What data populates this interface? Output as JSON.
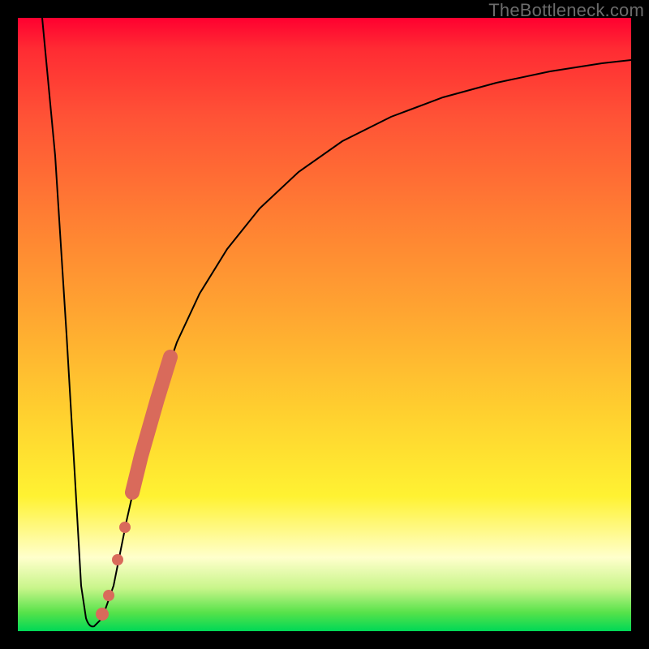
{
  "watermark": "TheBottleneck.com",
  "colors": {
    "frame": "#000000",
    "curve": "#000000",
    "markers": "#d96a5b",
    "gradient_stops": [
      "#ff0030",
      "#ff2b33",
      "#ff5236",
      "#ff7d33",
      "#ffa531",
      "#ffcf2f",
      "#fff232",
      "#ffffcc",
      "#c8f58a",
      "#56e24a",
      "#00d856"
    ]
  },
  "chart_data": {
    "type": "line",
    "title": "",
    "xlabel": "",
    "ylabel": "",
    "xlim": [
      0,
      100
    ],
    "ylim": [
      0,
      100
    ],
    "note": "x/y values are approximate, read from pixel positions; y=0 is bottom (green), y=100 is top (red). Curve shows bottleneck % vs component balance; dip near x≈11 is the optimal (0% bottleneck) point.",
    "series": [
      {
        "name": "bottleneck-curve",
        "x": [
          4,
          6,
          8,
          9,
          10,
          11,
          12,
          14,
          16,
          18,
          20,
          22,
          25,
          28,
          32,
          36,
          40,
          45,
          50,
          56,
          62,
          70,
          78,
          86,
          94,
          100
        ],
        "y": [
          100,
          78,
          48,
          24,
          6,
          1,
          1,
          6,
          18,
          28,
          36,
          43,
          52,
          58,
          65,
          70,
          74,
          78,
          81,
          84,
          86,
          88,
          90,
          91.5,
          92.5,
          93
        ]
      }
    ],
    "markers": {
      "name": "highlighted-range",
      "description": "thick salmon markers along rising branch of curve",
      "points": [
        {
          "x": 13.5,
          "y": 3
        },
        {
          "x": 15.0,
          "y": 10
        },
        {
          "x": 16.5,
          "y": 16
        },
        {
          "x": 18.0,
          "y": 23
        },
        {
          "x": 20.0,
          "y": 33
        },
        {
          "x": 22.0,
          "y": 42
        },
        {
          "x": 24.0,
          "y": 49
        }
      ]
    }
  }
}
